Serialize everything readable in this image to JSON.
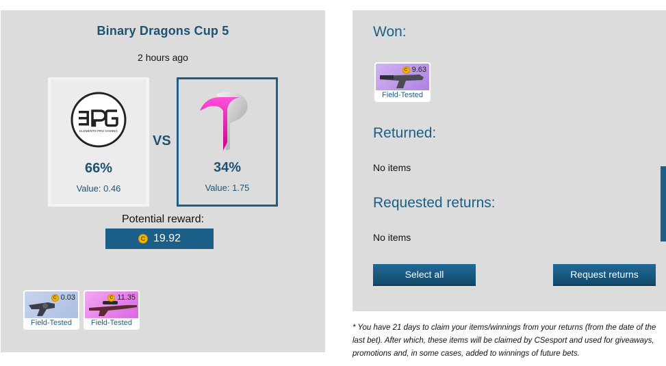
{
  "match": {
    "title": "Binary Dragons Cup 5",
    "time": "2 hours ago",
    "vs_label": "VS",
    "team1": {
      "logo_text": "EPG",
      "logo_subtext": "ELEMENTS PRO GAMING",
      "percent": "66%",
      "value": "Value: 0.46"
    },
    "team2": {
      "logo_name": "tp-logo",
      "percent": "34%",
      "value": "Value: 1.75"
    },
    "reward_label": "Potential reward:",
    "reward_value": "19.92",
    "coin_symbol": "C",
    "bet_items": [
      {
        "price": "0.03",
        "condition": "Field-Tested",
        "rarity_color": "#b5c6e8"
      },
      {
        "price": "11.35",
        "condition": "Field-Tested",
        "rarity_color": "#e07ae8"
      }
    ]
  },
  "results": {
    "won_title": "Won:",
    "won_items": [
      {
        "price": "9.63",
        "condition": "Field-Tested",
        "rarity_color": "#b890e8"
      }
    ],
    "returned_title": "Returned:",
    "returned_empty": "No items",
    "requested_title": "Requested returns:",
    "requested_empty": "No items",
    "select_all_label": "Select all",
    "request_returns_label": "Request returns"
  },
  "footnote": "* You have 21 days to claim your items/winnings from your returns (from the date of the last bet). After which, these items will be claimed by CSesport and used for giveaways, promotions and, in some cases, added to winnings of future bets.",
  "colors": {
    "accent": "#1b5e87",
    "panel_bg": "#dcdcdc"
  }
}
